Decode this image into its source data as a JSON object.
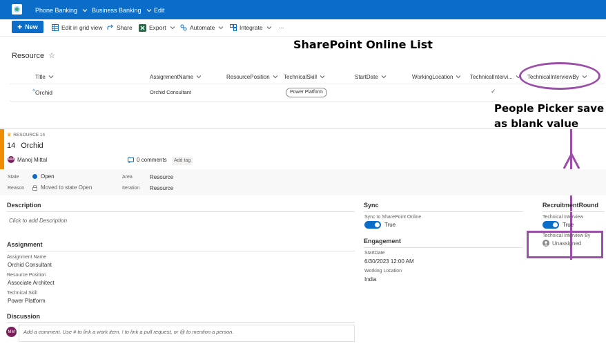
{
  "suite": {
    "nav_items": [
      "Phone Banking",
      "Business Banking",
      "Edit"
    ]
  },
  "command_bar": {
    "new_label": "New",
    "items": [
      "Edit in grid view",
      "Share",
      "Export",
      "Automate",
      "Integrate"
    ],
    "more": "···"
  },
  "annotation": {
    "heading": "SharePoint Online List",
    "note": "People Picker save as blank value"
  },
  "list": {
    "title": "Resource",
    "columns": [
      "Title",
      "AssignmentName",
      "ResourcePosition",
      "TechnicalSkill",
      "StartDate",
      "WorkingLocation",
      "TechnicalIntervi...",
      "TechnicalInterviewBy"
    ],
    "row": {
      "title": "Orchid",
      "assignment_name": "Orchid Consultant",
      "technical_skill": "Power Platform",
      "technical_interview_mark": "✓"
    }
  },
  "work_item": {
    "type_label": "RESOURCE 14",
    "id": "14",
    "title": "Orchid",
    "assignee_initials": "MM",
    "assignee": "Manoj Mittal",
    "comments": "0 comments",
    "add_tag": "Add tag",
    "state_label": "State",
    "state_value": "Open",
    "reason_label": "Reason",
    "reason_value": "Moved to state Open",
    "area_label": "Area",
    "area_value": "Resource",
    "iteration_label": "Iteration",
    "iteration_value": "Resource",
    "description_header": "Description",
    "description_hint": "Click to add Description",
    "assignment_header": "Assignment",
    "assignment_name_label": "Assignment Name",
    "assignment_name_value": "Orchid Consultant",
    "resource_position_label": "Resource Position",
    "resource_position_value": "Associate Architect",
    "technical_skill_label": "Technical Skill",
    "technical_skill_value": "Power Platform",
    "discussion_header": "Discussion",
    "comment_initials": "MM",
    "comment_placeholder": "Add a comment. Use # to link a work item, ! to link a pull request, or @ to mention a person.",
    "sync_header": "Sync",
    "sync_label": "Sync to SharePoint Online",
    "sync_value": "True",
    "engagement_header": "Engagement",
    "start_date_label": "StartDate",
    "start_date_value": "6/30/2023 12:00 AM",
    "working_location_label": "Working Location",
    "working_location_value": "India",
    "recruitment_header": "RecruitmentRound",
    "tech_interview_label": "Technical Interview",
    "tech_interview_value": "True",
    "tech_interview_by_label": "Technical Interview By",
    "tech_interview_by_value": "Unassigned"
  },
  "colors": {
    "brand_blue": "#0b6dc8",
    "annotation_purple": "#9b4fa8",
    "work_item_orange": "#f08c00"
  }
}
